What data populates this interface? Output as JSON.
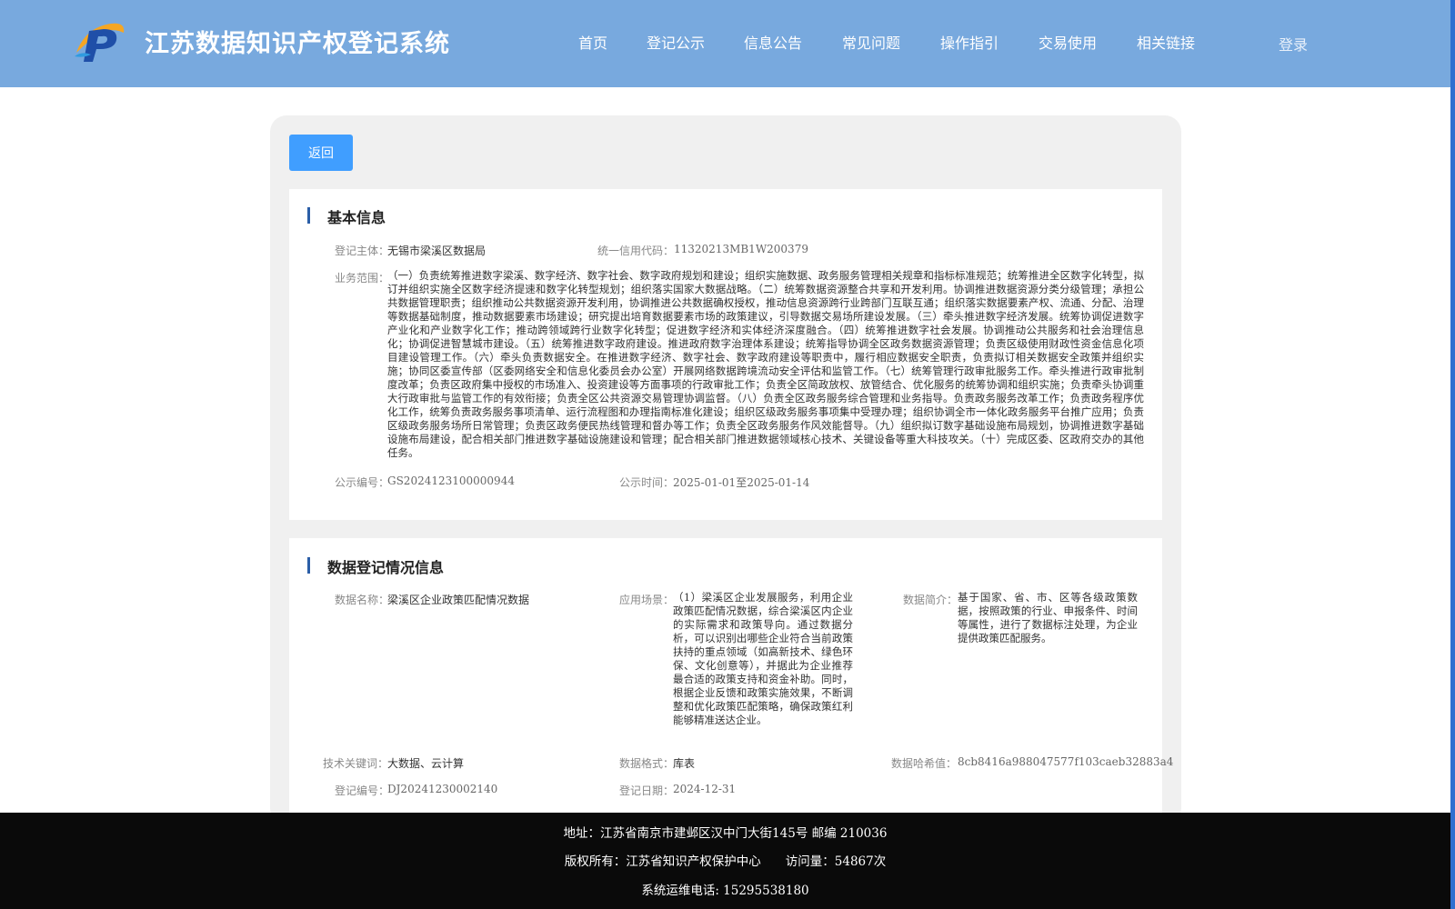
{
  "header": {
    "title": "江苏数据知识产权登记系统",
    "nav": [
      "首页",
      "登记公示",
      "信息公告",
      "常见问题",
      "操作指引",
      "交易使用",
      "相关链接"
    ],
    "login": "登录",
    "colors": {
      "bar": "#78a9de",
      "accent": "#409eff"
    }
  },
  "back_button": "返回",
  "basic": {
    "section_title": "基本信息",
    "subject_label": "登记主体：",
    "subject": "无锡市梁溪区数据局",
    "credit_label": "统一信用代码：",
    "credit": "11320213MB1W200379",
    "scope_label": "业务范围：",
    "scope": "（一）负责统筹推进数字梁溪、数字经济、数字社会、数字政府规划和建设；组织实施数据、政务服务管理相关规章和指标标准规范；统筹推进全区数字化转型，拟订并组织实施全区数字经济提速和数字化转型规划；组织落实国家大数据战略。（二）统筹数据资源整合共享和开发利用。协调推进数据资源分类分级管理；承担公共数据管理职责；组织推动公共数据资源开发利用，协调推进公共数据确权授权，推动信息资源跨行业跨部门互联互通；组织落实数据要素产权、流通、分配、治理等数据基础制度，推动数据要素市场建设；研究提出培育数据要素市场的政策建议，引导数据交易场所建设发展。（三）牵头推进数字经济发展。统筹协调促进数字产业化和产业数字化工作；推动跨领域跨行业数字化转型；促进数字经济和实体经济深度融合。（四）统筹推进数字社会发展。协调推动公共服务和社会治理信息化；协调促进智慧城市建设。（五）统筹推进数字政府建设。推进政府数字治理体系建设；统筹指导协调全区政务数据资源管理；负责区级使用财政性资金信息化项目建设管理工作。（六）牵头负责数据安全。在推进数字经济、数字社会、数字政府建设等职责中，履行相应数据安全职责，负责拟订相关数据安全政策并组织实施；协同区委宣传部（区委网络安全和信息化委员会办公室）开展网络数据跨境流动安全评估和监管工作。（七）统筹管理行政审批服务工作。牵头推进行政审批制度改革；负责区政府集中授权的市场准入、投资建设等方面事项的行政审批工作；负责全区简政放权、放管结合、优化服务的统筹协调和组织实施；负责牵头协调重大行政审批与监管工作的有效衔接；负责全区公共资源交易管理协调监督。（八）负责全区政务服务综合管理和业务指导。负责政务服务改革工作；负责政务程序优化工作，统筹负责政务服务事项清单、运行流程图和办理指南标准化建设；组织区级政务服务事项集中受理办理；组织协调全市一体化政务服务平台推广应用；负责区级政务服务场所日常管理；负责区政务便民热线管理和督办等工作；负责全区政务服务作风效能督导。（九）组织拟订数字基础设施布局规划，协调推进数字基础设施布局建设，配合相关部门推进数字基础设施建设和管理；配合相关部门推进数据领域核心技术、关键设备等重大科技攻关。（十）完成区委、区政府交办的其他任务。",
    "notice_no_label": "公示编号：",
    "notice_no": "GS2024123100000944",
    "notice_time_label": "公示时间：",
    "notice_time": "2025-01-01至2025-01-14"
  },
  "data_reg": {
    "section_title": "数据登记情况信息",
    "name_label": "数据名称：",
    "name": "梁溪区企业政策匹配情况数据",
    "scene_label": "应用场景：",
    "scene": "（1）梁溪区企业发展服务，利用企业政策匹配情况数据，综合梁溪区内企业的实际需求和政策导向。通过数据分析，可以识别出哪些企业符合当前政策扶持的重点领域（如高新技术、绿色环保、文化创意等），并据此为企业推荐最合适的政策支持和资金补助。同时，根据企业反馈和政策实施效果，不断调整和优化政策匹配策略，确保政策红利能够精准送达企业。",
    "intro_label": "数据简介：",
    "intro": "基于国家、省、市、区等各级政策数据，按照政策的行业、申报条件、时间等属性，进行了数据标注处理，为企业提供政策匹配服务。",
    "keyword_label": "技术关键词：",
    "keyword": "大数据、云计算",
    "format_label": "数据格式：",
    "format": "库表",
    "hash_label": "数据哈希值：",
    "hash": "8cb8416a988047577f103caeb32883a4",
    "reg_no_label": "登记编号：",
    "reg_no": "DJ20241230002140",
    "reg_date_label": "登记日期：",
    "reg_date": "2024-12-31"
  },
  "footer": {
    "address": "地址：江苏省南京市建邺区汉中门大街145号 邮编 210036",
    "copyright": "版权所有：江苏省知识产权保护中心　　访问量：54867次",
    "phone": "系统运维电话: 15295538180"
  }
}
